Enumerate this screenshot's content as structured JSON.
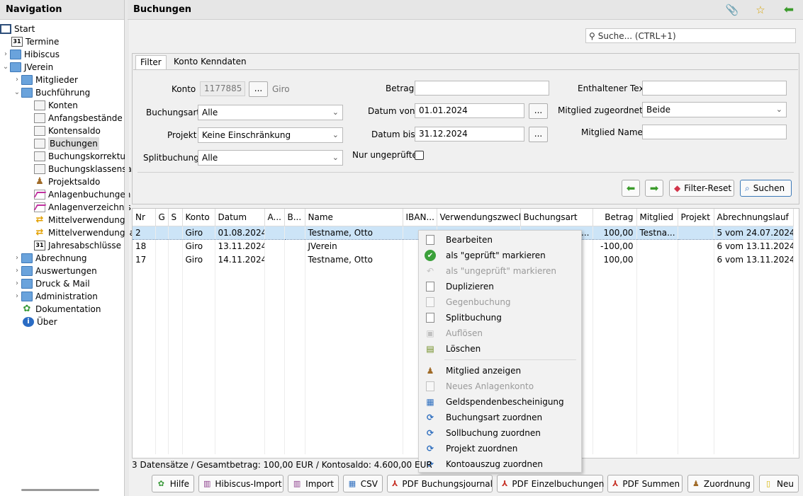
{
  "nav": {
    "title": "Navigation",
    "items": [
      {
        "label": "Start",
        "icon": "monitor-icon"
      },
      {
        "label": "Termine",
        "icon": "calendar-icon"
      },
      {
        "label": "Hibiscus",
        "icon": "folder-icon"
      },
      {
        "label": "JVerein",
        "icon": "folder-icon"
      },
      {
        "label": "Mitglieder",
        "icon": "folder-icon"
      },
      {
        "label": "Buchführung",
        "icon": "folder-icon"
      },
      {
        "label": "Konten",
        "icon": "document-icon"
      },
      {
        "label": "Anfangsbestände",
        "icon": "document-icon"
      },
      {
        "label": "Kontensaldo",
        "icon": "document-icon"
      },
      {
        "label": "Buchungen",
        "icon": "book-icon"
      },
      {
        "label": "Buchungskorrektur",
        "icon": "book-icon"
      },
      {
        "label": "Buchungsklassensal",
        "icon": "book-icon"
      },
      {
        "label": "Projektsaldo",
        "icon": "user-icon"
      },
      {
        "label": "Anlagenbuchungen",
        "icon": "chart-icon"
      },
      {
        "label": "Anlagenverzeichnis",
        "icon": "chart-icon"
      },
      {
        "label": "Mittelverwendung",
        "icon": "swap-icon"
      },
      {
        "label": "Mittelverwendungsa",
        "icon": "swap-icon"
      },
      {
        "label": "Jahresabschlüsse",
        "icon": "calendar-icon"
      },
      {
        "label": "Abrechnung",
        "icon": "folder-icon"
      },
      {
        "label": "Auswertungen",
        "icon": "folder-icon"
      },
      {
        "label": "Druck & Mail",
        "icon": "folder-icon"
      },
      {
        "label": "Administration",
        "icon": "folder-icon"
      },
      {
        "label": "Dokumentation",
        "icon": "documentation-icon"
      },
      {
        "label": "Über",
        "icon": "info-icon"
      }
    ],
    "calendar_glyph": "31"
  },
  "header": {
    "title": "Buchungen"
  },
  "search": {
    "placeholder": "Suche...   (CTRL+1)"
  },
  "filter": {
    "tabs": [
      "Filter",
      "Konto Kenndaten"
    ],
    "konto_label": "Konto",
    "konto_value": "1177885",
    "konto_name": "Giro",
    "buchungsart_label": "Buchungsart",
    "buchungsart_value": "Alle",
    "projekt_label": "Projekt",
    "projekt_value": "Keine Einschränkung",
    "splitbuchung_label": "Splitbuchung",
    "splitbuchung_value": "Alle",
    "betrag_label": "Betrag",
    "betrag_value": "",
    "datum_von_label": "Datum von",
    "datum_von_value": "01.01.2024",
    "datum_bis_label": "Datum bis",
    "datum_bis_value": "31.12.2024",
    "nur_ungepruefte_label": "Nur ungeprüfte",
    "text_label": "Enthaltener Text",
    "text_value": "",
    "mitglied_zugeordnet_label": "Mitglied zugeordnet?",
    "mitglied_zugeordnet_value": "Beide",
    "mitglied_name_label": "Mitglied Name",
    "mitglied_name_value": "",
    "dots": "...",
    "filter_reset_label": "Filter-Reset",
    "suchen_label": "Suchen"
  },
  "table": {
    "columns": [
      "Nr",
      "G",
      "S",
      "Konto",
      "Datum",
      "A...",
      "B...",
      "Name",
      "IBAN...",
      "Verwendungszweck",
      "Buchungsart",
      "Betrag",
      "Mitglied",
      "Projekt",
      "Abrechnungslauf"
    ],
    "rows": [
      {
        "nr": "2",
        "konto": "Giro",
        "datum": "01.08.2024",
        "name": "Testname, Otto",
        "buchungsart": "...",
        "betrag": "100,00",
        "mitglied": "Testna...",
        "abrechnung": "5 vom 24.07.2024"
      },
      {
        "nr": "18",
        "konto": "Giro",
        "datum": "13.11.2024",
        "name": "JVerein",
        "buchungsart": "",
        "betrag": "-100,00",
        "mitglied": "",
        "abrechnung": "6 vom 13.11.2024"
      },
      {
        "nr": "17",
        "konto": "Giro",
        "datum": "14.11.2024",
        "name": "Testname, Otto",
        "buchungsart": "",
        "betrag": "100,00",
        "mitglied": "",
        "abrechnung": "6 vom 13.11.2024"
      }
    ]
  },
  "context_menu": {
    "items": [
      {
        "label": "Bearbeiten",
        "enabled": true,
        "icon": "page-icon"
      },
      {
        "label": "als \"geprüft\" markieren",
        "enabled": true,
        "icon": "check-icon"
      },
      {
        "label": "als \"ungeprüft\" markieren",
        "enabled": false,
        "icon": "undo-icon"
      },
      {
        "label": "Duplizieren",
        "enabled": true,
        "icon": "copy-icon"
      },
      {
        "label": "Gegenbuchung",
        "enabled": false,
        "icon": "copy-icon"
      },
      {
        "label": "Splitbuchung",
        "enabled": true,
        "icon": "copy-icon"
      },
      {
        "label": "Auflösen",
        "enabled": false,
        "icon": "dissolve-icon"
      },
      {
        "label": "Löschen",
        "enabled": true,
        "icon": "trash-icon"
      },
      {
        "label": "Mitglied anzeigen",
        "enabled": true,
        "icon": "members-icon"
      },
      {
        "label": "Neues Anlagenkonto",
        "enabled": false,
        "icon": "page-icon"
      },
      {
        "label": "Geldspendenbescheinigung",
        "enabled": true,
        "icon": "certificate-icon"
      },
      {
        "label": "Buchungsart zuordnen",
        "enabled": true,
        "icon": "refresh-icon"
      },
      {
        "label": "Sollbuchung zuordnen",
        "enabled": true,
        "icon": "refresh-icon"
      },
      {
        "label": "Projekt zuordnen",
        "enabled": true,
        "icon": "refresh-icon"
      },
      {
        "label": "Kontoauszug zuordnen",
        "enabled": true,
        "icon": "refresh-icon"
      }
    ]
  },
  "status": {
    "text": "3 Datensätze / Gesamtbetrag: 100,00 EUR / Kontosaldo: 4.600,00 EUR"
  },
  "bottom_buttons": {
    "hilfe": "Hilfe",
    "hibiscus_import": "Hibiscus-Import",
    "import": "Import",
    "csv": "CSV",
    "pdf_journal": "PDF Buchungsjournal",
    "pdf_einzel": "PDF Einzelbuchungen",
    "pdf_summen": "PDF Summen",
    "zuordnung": "Zuordnung",
    "neu": "Neu"
  },
  "colors": {
    "selection": "#cce4f7",
    "accent_green": "#3a9a2a",
    "folder": "#6aa3dc"
  }
}
